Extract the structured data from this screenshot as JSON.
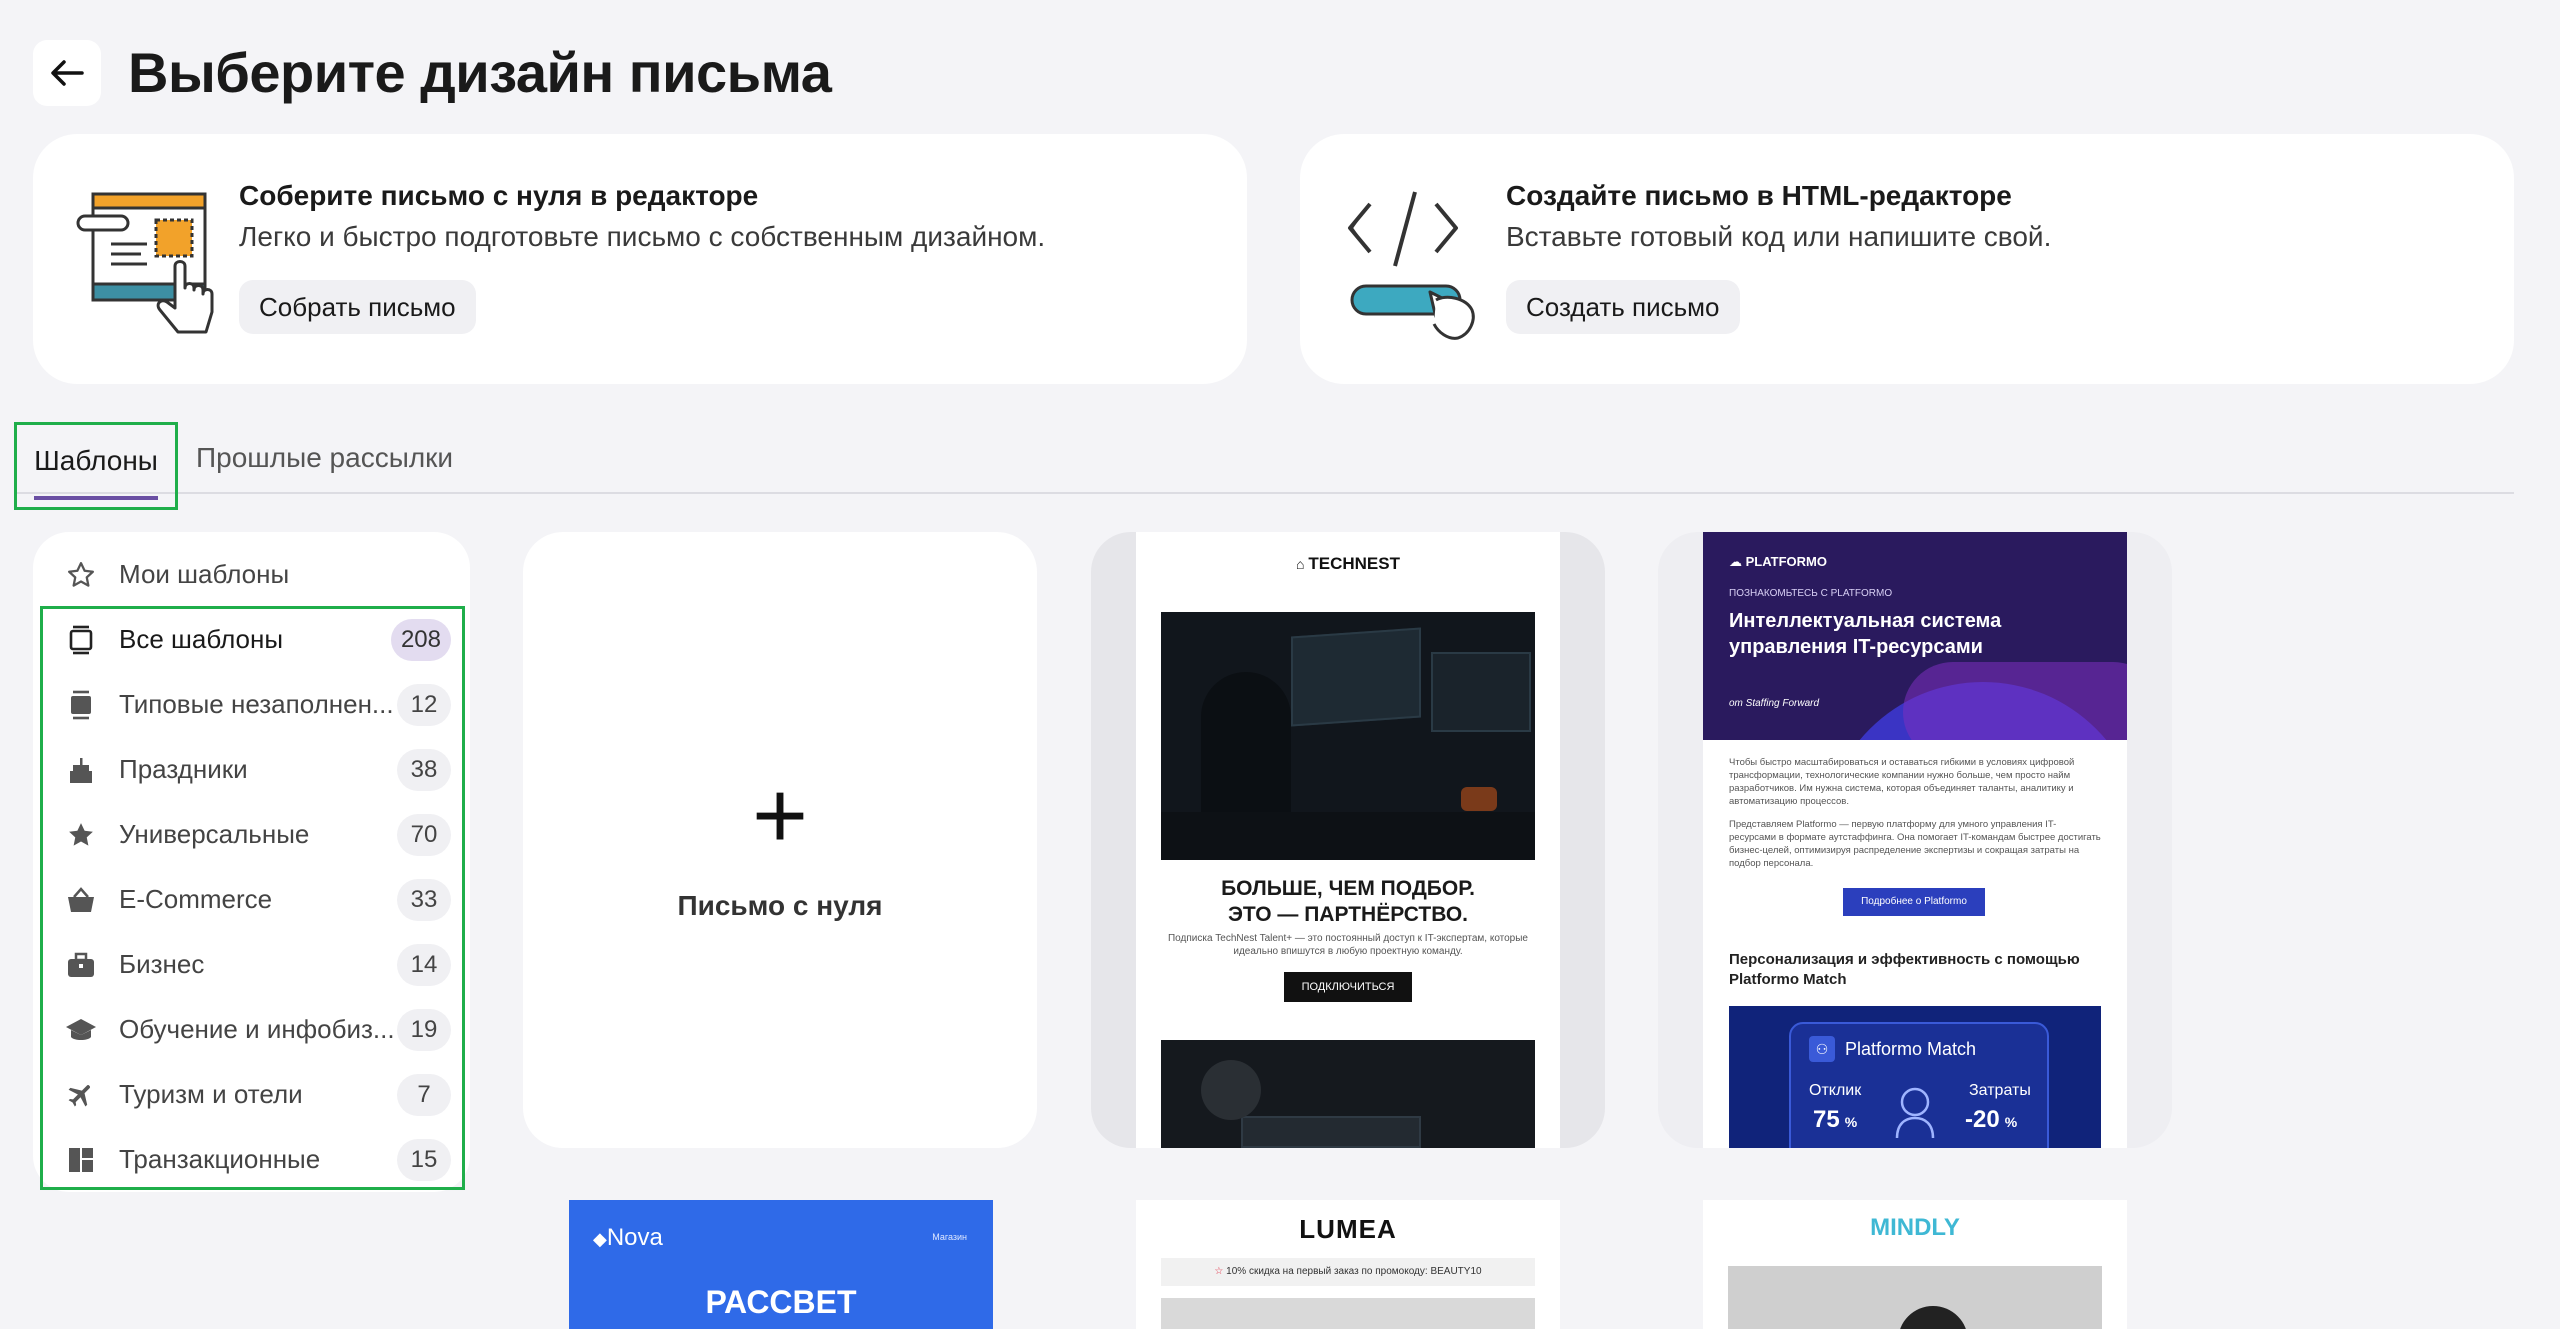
{
  "header": {
    "title": "Выберите дизайн письма"
  },
  "cards": [
    {
      "title": "Соберите письмо с нуля в редакторе",
      "desc": "Легко и быстро подготовьте письмо с собственным дизайном.",
      "button": "Собрать письмо"
    },
    {
      "title": "Создайте письмо в HTML-редакторе",
      "desc": "Вставьте готовый код или напишите свой.",
      "button": "Создать письмо"
    }
  ],
  "tabs": [
    {
      "label": "Шаблоны"
    },
    {
      "label": "Прошлые рассылки"
    }
  ],
  "sidebar": {
    "items": [
      {
        "label": "Мои шаблоны",
        "count": ""
      },
      {
        "label": "Все шаблоны",
        "count": "208"
      },
      {
        "label": "Типовые незаполнен...",
        "count": "12"
      },
      {
        "label": "Праздники",
        "count": "38"
      },
      {
        "label": "Универсальные",
        "count": "70"
      },
      {
        "label": "E-Commerce",
        "count": "33"
      },
      {
        "label": "Бизнес",
        "count": "14"
      },
      {
        "label": "Обучение и инфобиз...",
        "count": "19"
      },
      {
        "label": "Туризм и отели",
        "count": "7"
      },
      {
        "label": "Транзакционные",
        "count": "15"
      }
    ]
  },
  "blank": {
    "plus": "+",
    "label": "Письмо с нуля"
  },
  "technest": {
    "logo": "TECHNEST",
    "headline1": "БОЛЬШЕ, ЧЕМ ПОДБОР.",
    "headline2": "ЭТО — ПАРТНЁРСТВО.",
    "body": "Подписка TechNest Talent+ — это постоянный доступ к IT-экспертам, которые идеально впишутся в любую проектную команду.",
    "button": "ПОДКЛЮЧИТЬСЯ"
  },
  "platformo": {
    "logo": "PLATFORMO",
    "kicker": "ПОЗНАКОМЬТЕСЬ С PLATFORMO",
    "headline": "Интеллектуальная система управления IT-ресурсами",
    "byline": "от Staffing Forward",
    "para1": "Чтобы быстро масштабироваться и оставаться гибкими в условиях цифровой трансформации, технологические компании нужно больше, чем просто найм разработчиков. Им нужна система, которая объединяет таланты, аналитику и автоматизацию процессов.",
    "para2": "Представляем Platformo — первую платформу для умного управления IT-ресурсами в формате аутстаффинга. Она помогает IT-командам быстрее достигать бизнес-целей, оптимизируя распределение экспертизы и сокращая затраты на подбор персонала.",
    "button": "Подробнее о Platformo",
    "subhead": "Персонализация и эффективность с помощью Platformo Match",
    "match_title": "Platformo Match",
    "stat1_label": "Отклик",
    "stat1_value": "75",
    "stat1_unit": "%",
    "stat2_label": "Затраты",
    "stat2_value": "-20",
    "stat2_unit": "%"
  },
  "nova": {
    "logo": "Nova",
    "nav": "Магазин",
    "headline": "РАССВЕТ"
  },
  "lumea": {
    "logo": "LUMEA",
    "promo": "10% скидка на первый заказ по промокоду: BEAUTY10"
  },
  "mindly": {
    "logo": "MINDLY"
  },
  "colors": {
    "accent": "#6a4fa3",
    "highlight": "#1fae4a",
    "navy": "#1b2a8c",
    "blue": "#2f6ae8"
  }
}
